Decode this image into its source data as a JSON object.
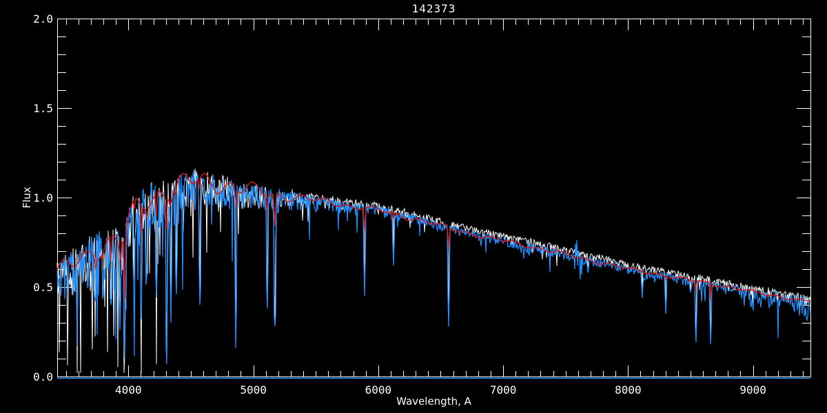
{
  "window": {
    "background": "#000000"
  },
  "chart_data": {
    "type": "line",
    "title": "142373",
    "xlabel": "Wavelength, A",
    "ylabel": "Flux",
    "xlim": [
      3430,
      9460
    ],
    "ylim": [
      0.0,
      2.0
    ],
    "x_major_ticks": [
      4000,
      5000,
      6000,
      7000,
      8000,
      9000
    ],
    "x_minor_step": 100,
    "y_major_ticks": [
      0.0,
      0.5,
      1.0,
      1.5,
      2.0
    ],
    "y_minor_step": 0.1,
    "grid": false,
    "axis_color": "#ffffff",
    "legend": null,
    "series": [
      {
        "name": "reference-spectrum",
        "color": "#ffffff",
        "stroke_width": 1.0,
        "role": "observed reference spectrum (white)"
      },
      {
        "name": "observed-spectrum",
        "color": "#1e8fff",
        "stroke_width": 1.25,
        "role": "observed spectrum with absorption-line forest (blue)"
      },
      {
        "name": "model-fit",
        "color": "#d81414",
        "stroke_width": 1.4,
        "role": "smooth model fit drawn on top (red)"
      }
    ],
    "zero_line": {
      "present": true,
      "color": "#1e8fff",
      "flux": 0.0
    },
    "continuum": {
      "lambda": [
        3430,
        3500,
        3600,
        3700,
        3800,
        3870,
        3920,
        3960,
        4000,
        4050,
        4150,
        4250,
        4350,
        4450,
        4550,
        4650,
        4750,
        4850,
        4950,
        5050,
        5200,
        5400,
        5600,
        5800,
        6000,
        6200,
        6400,
        6600,
        6800,
        7000,
        7200,
        7400,
        7600,
        7800,
        8000,
        8200,
        8400,
        8600,
        8800,
        9000,
        9200,
        9460
      ],
      "v": [
        0.62,
        0.65,
        0.7,
        0.74,
        0.77,
        0.79,
        0.78,
        0.8,
        0.9,
        0.97,
        1.02,
        1.05,
        1.07,
        1.1,
        1.12,
        1.11,
        1.09,
        1.07,
        1.06,
        1.05,
        1.03,
        1.01,
        0.99,
        0.965,
        0.945,
        0.91,
        0.875,
        0.835,
        0.8,
        0.77,
        0.74,
        0.71,
        0.675,
        0.645,
        0.61,
        0.585,
        0.56,
        0.535,
        0.51,
        0.48,
        0.455,
        0.425
      ]
    },
    "absorption_lines": [
      {
        "c": 3735,
        "f": 0.42,
        "w": 7,
        "r": 0.35
      },
      {
        "c": 3798,
        "f": 0.45,
        "w": 6,
        "r": 0.3
      },
      {
        "c": 3860,
        "f": 0.4,
        "w": 8,
        "r": 0.35
      },
      {
        "c": 3933,
        "f": 0.26,
        "w": 7,
        "r": 0.5
      },
      {
        "c": 3970,
        "f": 0.1,
        "w": 7,
        "r": 0.5
      },
      {
        "c": 4045,
        "f": 0.5,
        "w": 6,
        "r": 0.2
      },
      {
        "c": 4101,
        "f": 0.32,
        "w": 7,
        "r": 0.3
      },
      {
        "c": 4144,
        "f": 0.52,
        "w": 6,
        "r": 0.2
      },
      {
        "c": 4226,
        "f": 0.44,
        "w": 6,
        "r": 0.25
      },
      {
        "c": 4305,
        "f": 0.07,
        "w": 7,
        "r": 0.3
      },
      {
        "c": 4340,
        "f": 0.3,
        "w": 6,
        "r": 0.3
      },
      {
        "c": 4383,
        "f": 0.46,
        "w": 6,
        "r": 0.2
      },
      {
        "c": 4570,
        "f": 0.4,
        "w": 6,
        "r": 0.2
      },
      {
        "c": 4861,
        "f": 0.16,
        "w": 7,
        "r": 0.2
      },
      {
        "c": 5110,
        "f": 0.38,
        "w": 6,
        "r": 0.2
      },
      {
        "c": 5172,
        "f": 0.28,
        "w": 13,
        "r": 0.25
      },
      {
        "c": 5890,
        "f": 0.45,
        "w": 7,
        "r": 0.25
      },
      {
        "c": 6122,
        "f": 0.62,
        "w": 5,
        "r": 0.12
      },
      {
        "c": 6563,
        "f": 0.28,
        "w": 8,
        "r": 0.2
      },
      {
        "c": 7680,
        "f": 0.58,
        "w": 5,
        "r": 0.1
      },
      {
        "c": 8113,
        "f": 0.44,
        "w": 5,
        "r": 0.15
      },
      {
        "c": 8303,
        "f": 0.35,
        "w": 5,
        "r": 0.18
      },
      {
        "c": 8498,
        "f": 0.47,
        "w": 5,
        "r": 0.25
      },
      {
        "c": 8542,
        "f": 0.19,
        "w": 6,
        "r": 0.3
      },
      {
        "c": 8662,
        "f": 0.18,
        "w": 6,
        "r": 0.3
      },
      {
        "c": 8998,
        "f": 0.4,
        "w": 5,
        "r": 0.12
      }
    ],
    "telluric_bands": [
      {
        "c": 6872,
        "hw": 14,
        "up": 0.02,
        "down": 0.05
      },
      {
        "c": 7185,
        "hw": 45,
        "up": 0.03,
        "down": 0.06
      },
      {
        "c": 7605,
        "hw": 35,
        "up": 0.12,
        "down": 0.16
      },
      {
        "c": 8164,
        "hw": 55,
        "up": 0.015,
        "down": 0.04
      },
      {
        "c": 8950,
        "hw": 70,
        "up": 0.03,
        "down": 0.05
      },
      {
        "c": 9120,
        "hw": 90,
        "up": 0.05,
        "down": 0.07
      },
      {
        "c": 9380,
        "hw": 85,
        "up": 0.05,
        "down": 0.08
      }
    ],
    "noise": {
      "forest": {
        "lambda": [
          3430,
          3700,
          3950,
          4100,
          4400,
          4700,
          5000,
          5300,
          5600,
          6000,
          6400,
          6800,
          7200,
          7600,
          8000,
          8400,
          8800,
          9100,
          9460
        ],
        "v": [
          0.3,
          0.33,
          0.34,
          0.3,
          0.27,
          0.18,
          0.14,
          0.11,
          0.075,
          0.06,
          0.05,
          0.045,
          0.045,
          0.05,
          0.042,
          0.048,
          0.055,
          0.065,
          0.07
        ]
      },
      "spike_prob": {
        "lambda": [
          3430,
          4600,
          5200,
          5600,
          6000,
          9460
        ],
        "v": [
          0.1,
          0.07,
          0.05,
          0.03,
          0.018,
          0.018
        ]
      },
      "white_offset": {
        "lambda": [
          3430,
          5200,
          5600,
          6200,
          7000,
          9460
        ],
        "v": [
          0.0,
          0.0,
          0.012,
          0.02,
          0.025,
          0.02
        ]
      },
      "red_factor": {
        "lambda": [
          3430,
          3800,
          4200,
          4700,
          5400,
          9460
        ],
        "v": [
          0.925,
          0.95,
          0.975,
          0.985,
          0.985,
          0.985
        ]
      },
      "red_wiggle": {
        "lambda": [
          3430,
          4200,
          4800,
          5200,
          5600,
          6500,
          9460
        ],
        "v": [
          0.035,
          0.042,
          0.035,
          0.02,
          0.012,
          0.008,
          0.006
        ],
        "k1": 0.033,
        "k2": 0.0125
      },
      "seed_white": 99,
      "seed_blue": 1337,
      "seed_red": 7
    }
  }
}
